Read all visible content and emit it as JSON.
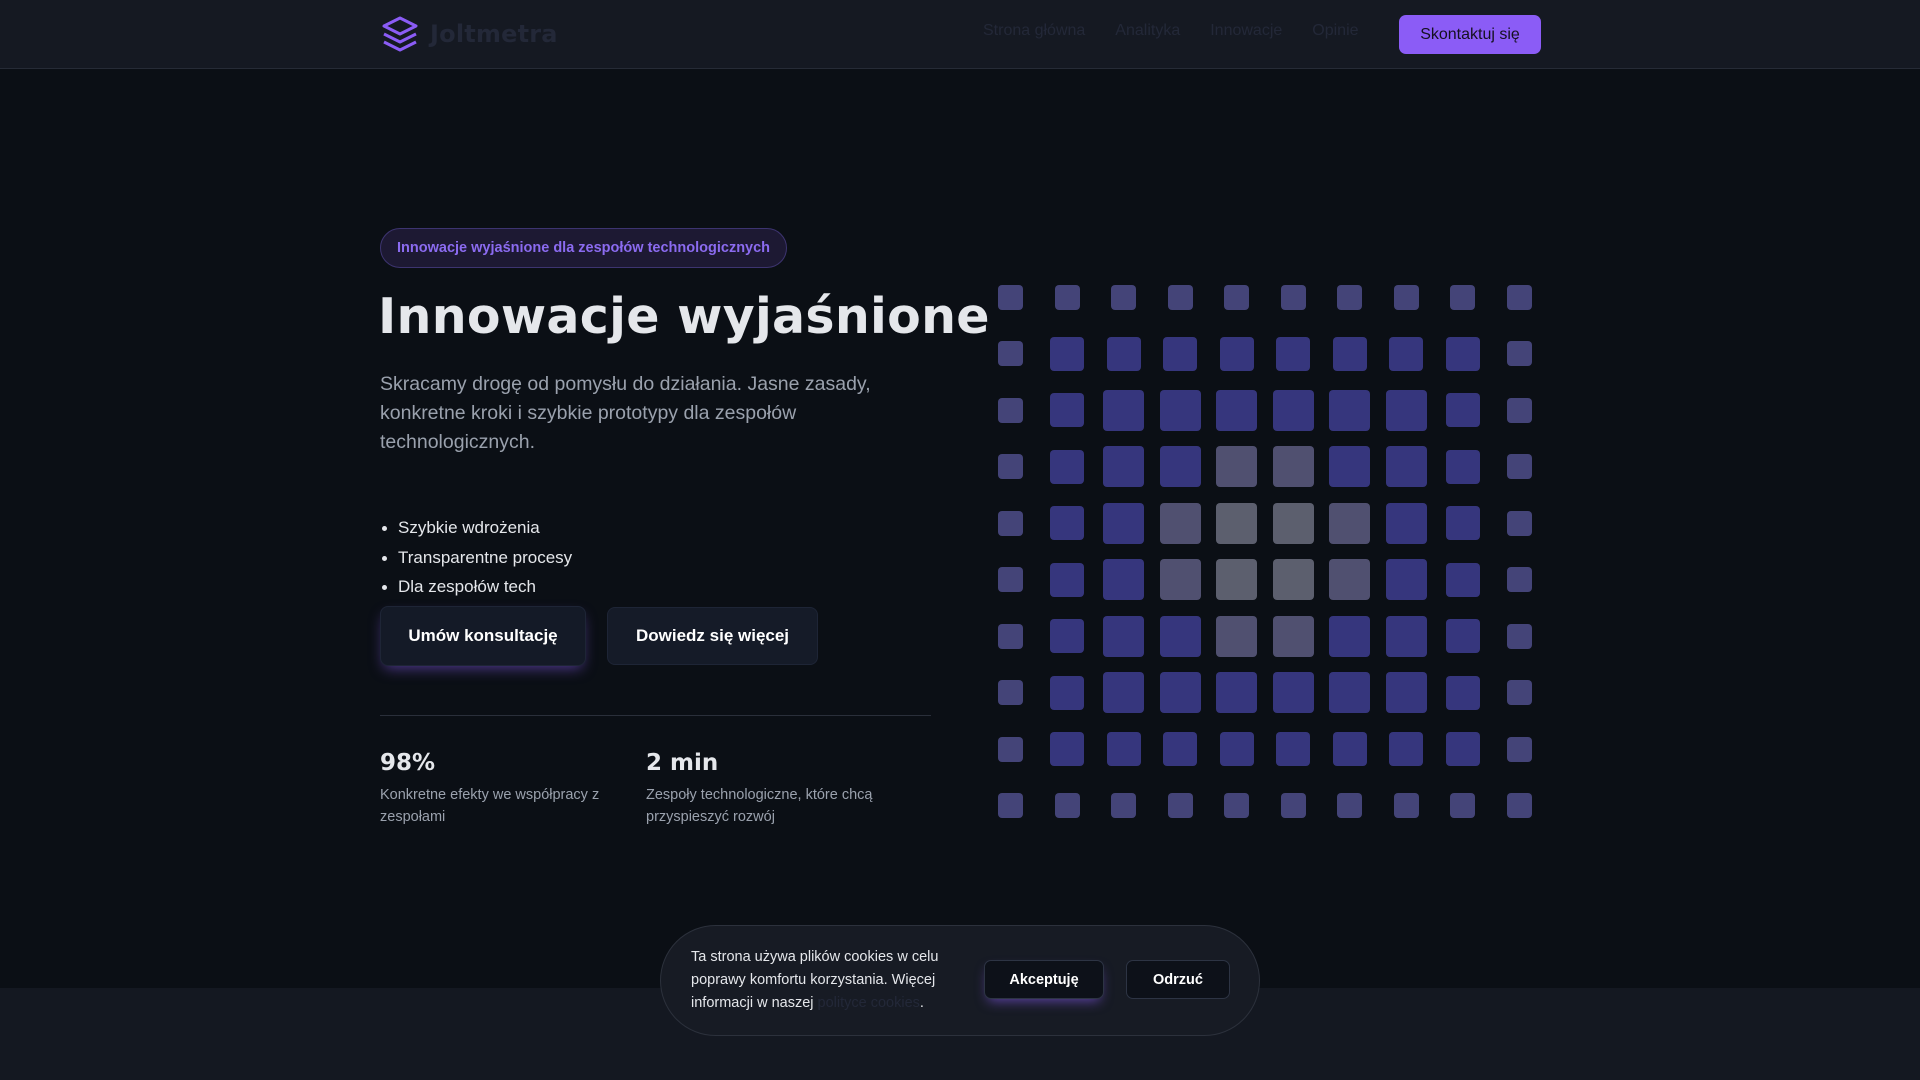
{
  "header": {
    "brand": "Joltmetra",
    "nav": [
      "Strona główna",
      "Analityka",
      "Innowacje",
      "Opinie"
    ],
    "cta_label": "Skontaktuj się"
  },
  "hero": {
    "badge": "Innowacje wyjaśnione dla zespołów technologicznych",
    "title": "Innowacje wyjaśnione",
    "description": "Skracamy drogę od pomysłu do działania. Jasne zasady, konkretne kroki i szybkie prototypy dla zespołów technologicznych.",
    "features": [
      "Szybkie wdrożenia",
      "Transparentne procesy",
      "Dla zespołów tech"
    ],
    "primary_button": "Umów konsultację",
    "secondary_button": "Dowiedz się więcej"
  },
  "stats": [
    {
      "value": "98%",
      "label": "Konkretne efekty we współpracy z zespołami"
    },
    {
      "value": "2 min",
      "label": "Zespoły technologiczne, które chcą przyspieszyć rozwój"
    }
  ],
  "cookie": {
    "text": "Ta strona używa plików cookies w celu poprawy komfortu korzystania. Więcej informacji w naszej",
    "link": "polityce cookies",
    "suffix": ".",
    "accept": "Akceptuję",
    "reject": "Odrzuć"
  },
  "colors": {
    "accent": "#8b5cf6",
    "background": "#0b0f15",
    "header": "#151922"
  },
  "icons": {
    "logo": "stacked-layers-icon"
  }
}
